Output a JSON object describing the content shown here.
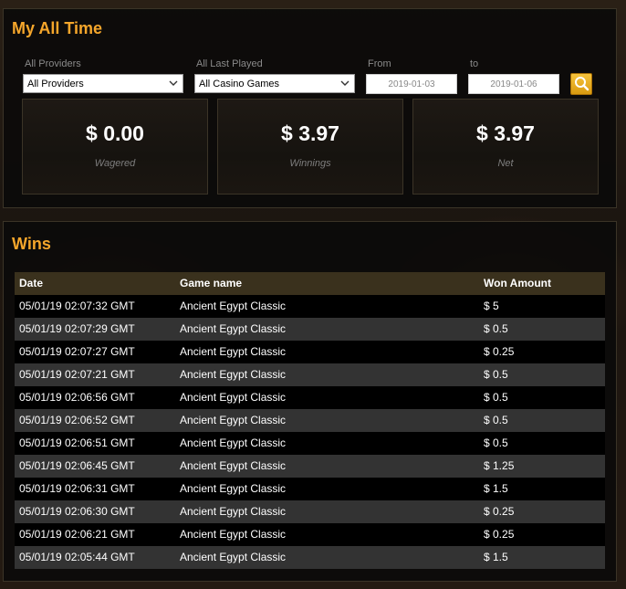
{
  "summary": {
    "title": "My All Time",
    "filters": {
      "providers_label": "All Providers",
      "providers_value": "All Providers",
      "last_played_label": "All Last Played",
      "last_played_value": "All Casino Games",
      "from_label": "From",
      "from_value": "2019-01-03",
      "to_label": "to",
      "to_value": "2019-01-06",
      "search_icon": "search-icon"
    },
    "stats": [
      {
        "value": "$ 0.00",
        "label": "Wagered"
      },
      {
        "value": "$ 3.97",
        "label": "Winnings"
      },
      {
        "value": "$ 3.97",
        "label": "Net"
      }
    ]
  },
  "wins": {
    "title": "Wins",
    "columns": [
      "Date",
      "Game name",
      "Won Amount"
    ],
    "rows": [
      {
        "date": "05/01/19 02:07:32 GMT",
        "game": "Ancient Egypt Classic",
        "amount": "$ 5"
      },
      {
        "date": "05/01/19 02:07:29 GMT",
        "game": "Ancient Egypt Classic",
        "amount": "$ 0.5"
      },
      {
        "date": "05/01/19 02:07:27 GMT",
        "game": "Ancient Egypt Classic",
        "amount": "$ 0.25"
      },
      {
        "date": "05/01/19 02:07:21 GMT",
        "game": "Ancient Egypt Classic",
        "amount": "$ 0.5"
      },
      {
        "date": "05/01/19 02:06:56 GMT",
        "game": "Ancient Egypt Classic",
        "amount": "$ 0.5"
      },
      {
        "date": "05/01/19 02:06:52 GMT",
        "game": "Ancient Egypt Classic",
        "amount": "$ 0.5"
      },
      {
        "date": "05/01/19 02:06:51 GMT",
        "game": "Ancient Egypt Classic",
        "amount": "$ 0.5"
      },
      {
        "date": "05/01/19 02:06:45 GMT",
        "game": "Ancient Egypt Classic",
        "amount": "$ 1.25"
      },
      {
        "date": "05/01/19 02:06:31 GMT",
        "game": "Ancient Egypt Classic",
        "amount": "$ 1.5"
      },
      {
        "date": "05/01/19 02:06:30 GMT",
        "game": "Ancient Egypt Classic",
        "amount": "$ 0.25"
      },
      {
        "date": "05/01/19 02:06:21 GMT",
        "game": "Ancient Egypt Classic",
        "amount": "$ 0.25"
      },
      {
        "date": "05/01/19 02:05:44 GMT",
        "game": "Ancient Egypt Classic",
        "amount": "$ 1.5"
      }
    ]
  },
  "colors": {
    "accent": "#f5a62b",
    "table_header": "#3a311d",
    "row_odd": "#000000",
    "row_even": "#333333"
  }
}
